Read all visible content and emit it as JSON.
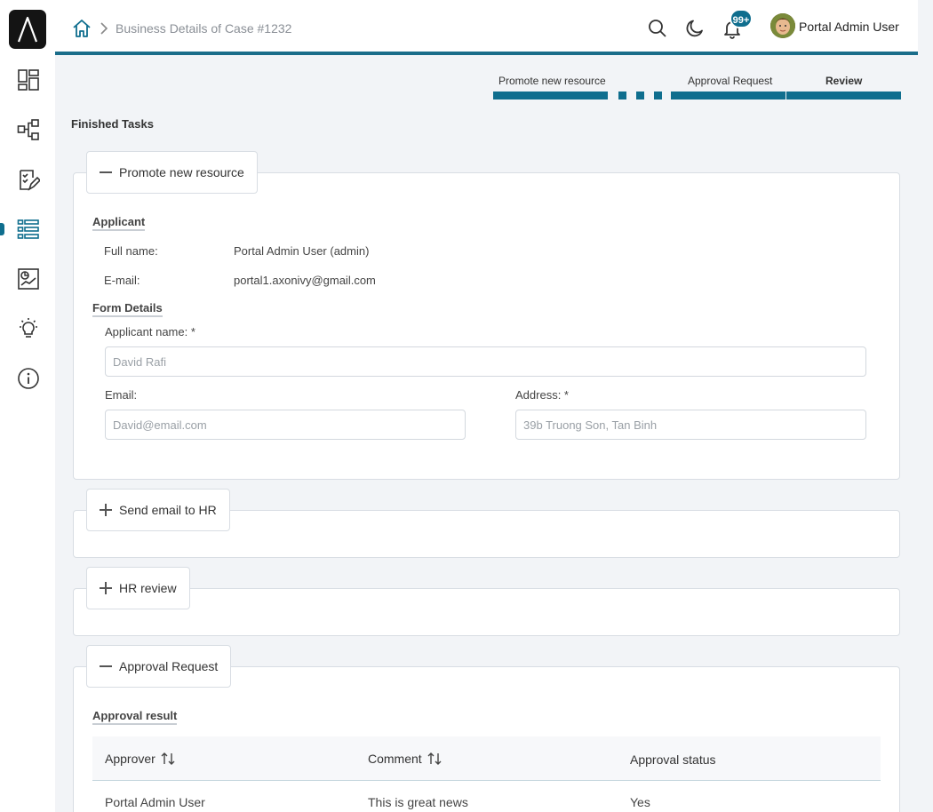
{
  "sidebar": {
    "items": [
      {
        "icon": "dashboard-icon"
      },
      {
        "icon": "process-icon"
      },
      {
        "icon": "task-list-icon"
      },
      {
        "icon": "case-list-icon"
      },
      {
        "icon": "statistics-icon"
      },
      {
        "icon": "idea-icon"
      },
      {
        "icon": "info-icon"
      }
    ],
    "active_index": 3
  },
  "header": {
    "breadcrumb": "Business Details of Case #1232",
    "notifications_badge": "99+",
    "user_name": "Portal Admin User"
  },
  "stepper": {
    "steps": [
      "Promote new resource",
      "Approval Request",
      "Review"
    ],
    "current": "Review"
  },
  "section_title": "Finished Tasks",
  "panels": {
    "promote": {
      "toggle_label": "Promote new resource",
      "applicant_heading": "Applicant",
      "full_name_label": "Full name:",
      "full_name_value": "Portal Admin User (admin)",
      "email_label": "E-mail:",
      "email_value": "portal1.axonivy@gmail.com",
      "form_heading": "Form Details",
      "applicant_name_label": "Applicant name: *",
      "applicant_name_value": "David Rafi",
      "email_field_label": "Email:",
      "email_field_value": "David@email.com",
      "address_label": "Address: *",
      "address_value": "39b Truong Son, Tan Binh"
    },
    "send_email": {
      "toggle_label": "Send email to HR"
    },
    "hr_review": {
      "toggle_label": "HR review"
    },
    "approval": {
      "toggle_label": "Approval Request",
      "result_heading": "Approval result",
      "columns": [
        "Approver",
        "Comment",
        "Approval status"
      ],
      "rows": [
        [
          "Portal Admin User",
          "This is great news",
          "Yes"
        ]
      ]
    }
  },
  "colors": {
    "accent": "#0f6e8e",
    "header_border": "#1a6d8a"
  }
}
